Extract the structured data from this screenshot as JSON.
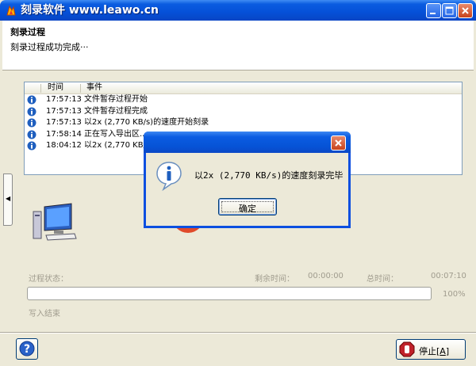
{
  "window": {
    "title": "刻录软件 www.leawo.cn",
    "controls": {
      "minimize_icon": "minimize-icon",
      "maximize_icon": "maximize-icon",
      "close_icon": "close-icon"
    }
  },
  "header": {
    "title": "刻录过程",
    "subtitle": "刻录过程成功完成···"
  },
  "event_list": {
    "columns": [
      "时间",
      "事件"
    ],
    "rows": [
      {
        "icon": "info-icon",
        "time": "17:57:13",
        "event": "文件暂存过程开始"
      },
      {
        "icon": "info-icon",
        "time": "17:57:13",
        "event": "文件暂存过程完成"
      },
      {
        "icon": "info-icon",
        "time": "17:57:13",
        "event": "以2x (2,770 KB/s)的速度开始刻录"
      },
      {
        "icon": "info-icon",
        "time": "17:58:14",
        "event": "正在写入导出区..."
      },
      {
        "icon": "info-icon",
        "time": "18:04:12",
        "event": "以2x (2,770 KB/s)"
      }
    ]
  },
  "status": {
    "process_label": "过程状态：",
    "remaining_label": "剩余时间：",
    "remaining_value": "00:00:00",
    "total_label": "总时间：",
    "total_value": "00:07:10",
    "progress_percent": "100%",
    "progress_fraction": 1.0,
    "write_end_label": "写入结束"
  },
  "footer": {
    "help_icon": "help-icon",
    "stop_label": "停止",
    "stop_hotkey": "A"
  },
  "dialog": {
    "message": "以2x (2,770 KB/s)的速度刻录完毕",
    "ok_label": "确定",
    "icon": "info-icon"
  },
  "colors": {
    "titlebar": "#0550d8",
    "window_bg": "#ece9d8",
    "info_blue": "#1f5fbf",
    "disabled_text": "#a09c8e"
  }
}
